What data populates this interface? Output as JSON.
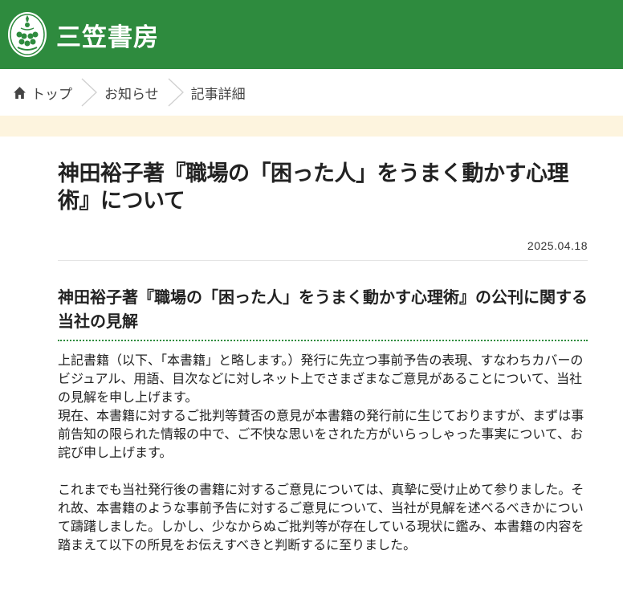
{
  "header": {
    "site_name": "三笠書房",
    "brand_color": "#2e8b3e"
  },
  "breadcrumb": {
    "home_icon": "home-icon",
    "items": [
      "トップ",
      "お知らせ",
      "記事詳細"
    ]
  },
  "article": {
    "title": "神田裕子著『職場の「困った人」をうまく動かす心理術』について",
    "date": "2025.04.18",
    "section_title": "神田裕子著『職場の「困った人」をうまく動かす心理術』の公刊に関する当社の見解",
    "paragraphs": [
      "上記書籍（以下、「本書籍」と略します。）発行に先立つ事前予告の表現、すなわちカバーのビジュアル、用語、目次などに対しネット上でさまざまなご意見があることについて、当社の見解を申し上げます。\n現在、本書籍に対するご批判等賛否の意見が本書籍の発行前に生じておりますが、まずは事前告知の限られた情報の中で、ご不快な思いをされた方がいらっしゃった事実について、お詫び申し上げます。",
      "これまでも当社発行後の書籍に対するご意見については、真摯に受け止めて参りました。それ故、本書籍のような事前予告に対するご意見について、当社が見解を述べるべきかについて躊躇しました。しかし、少なからぬご批判等が存在している現状に鑑み、本書籍の内容を踏まえて以下の所見をお伝えすべきと判断するに至りました。"
    ]
  }
}
